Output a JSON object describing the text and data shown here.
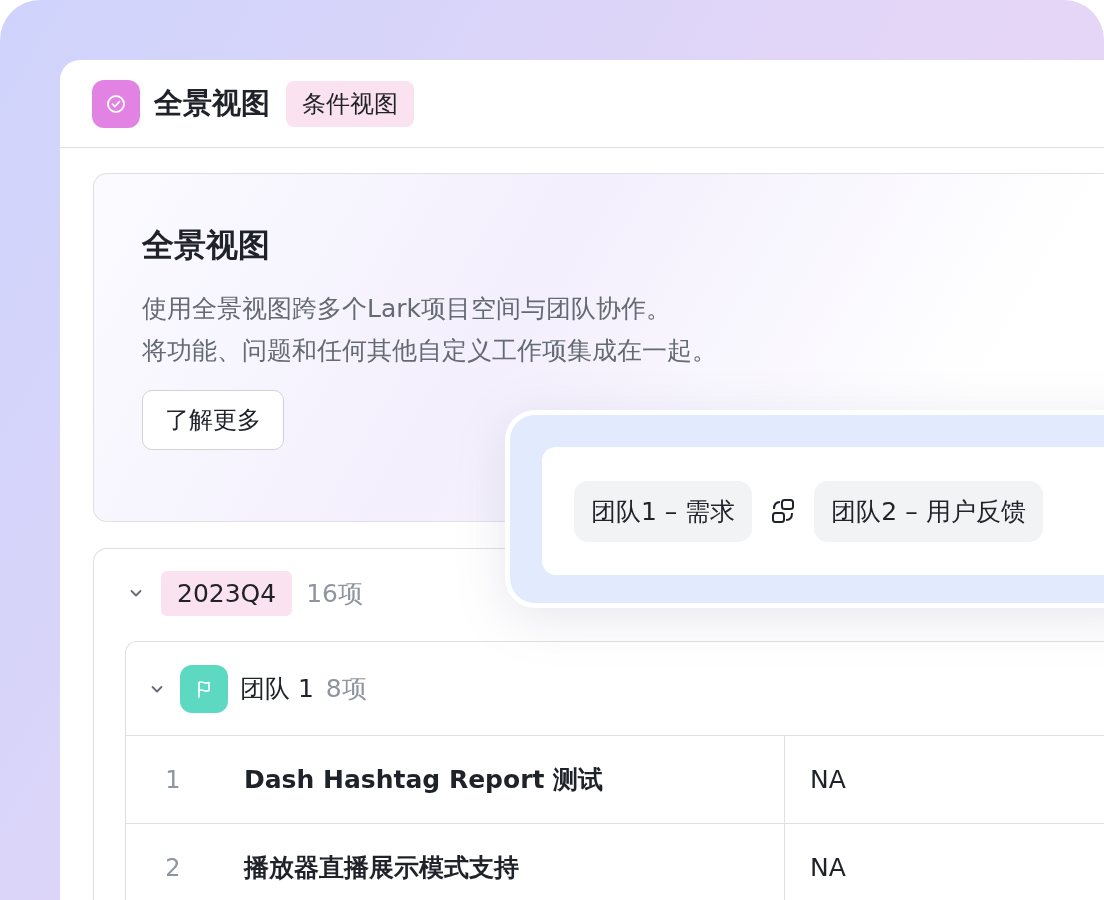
{
  "window": {
    "title": "全景视图",
    "tag": "条件视图"
  },
  "intro": {
    "title": "全景视图",
    "lines": [
      "使用全景视图跨多个Lark项目空间与团队协作。",
      "将功能、问题和任何其他自定义工作项集成在一起。"
    ],
    "button": "了解更多"
  },
  "link_panel": {
    "chips": [
      "团队1 – 需求",
      "团队2 – 用户反馈"
    ]
  },
  "group": {
    "label": "2023Q4",
    "count": "16项",
    "expanded": true,
    "subgroup": {
      "label": "团队 1",
      "count": "8项",
      "expanded": true,
      "rows": [
        {
          "index": "1",
          "title": "Dash Hashtag Report 测试",
          "value": "NA"
        },
        {
          "index": "2",
          "title": "播放器直播展示模式支持",
          "value": "NA"
        }
      ]
    }
  }
}
